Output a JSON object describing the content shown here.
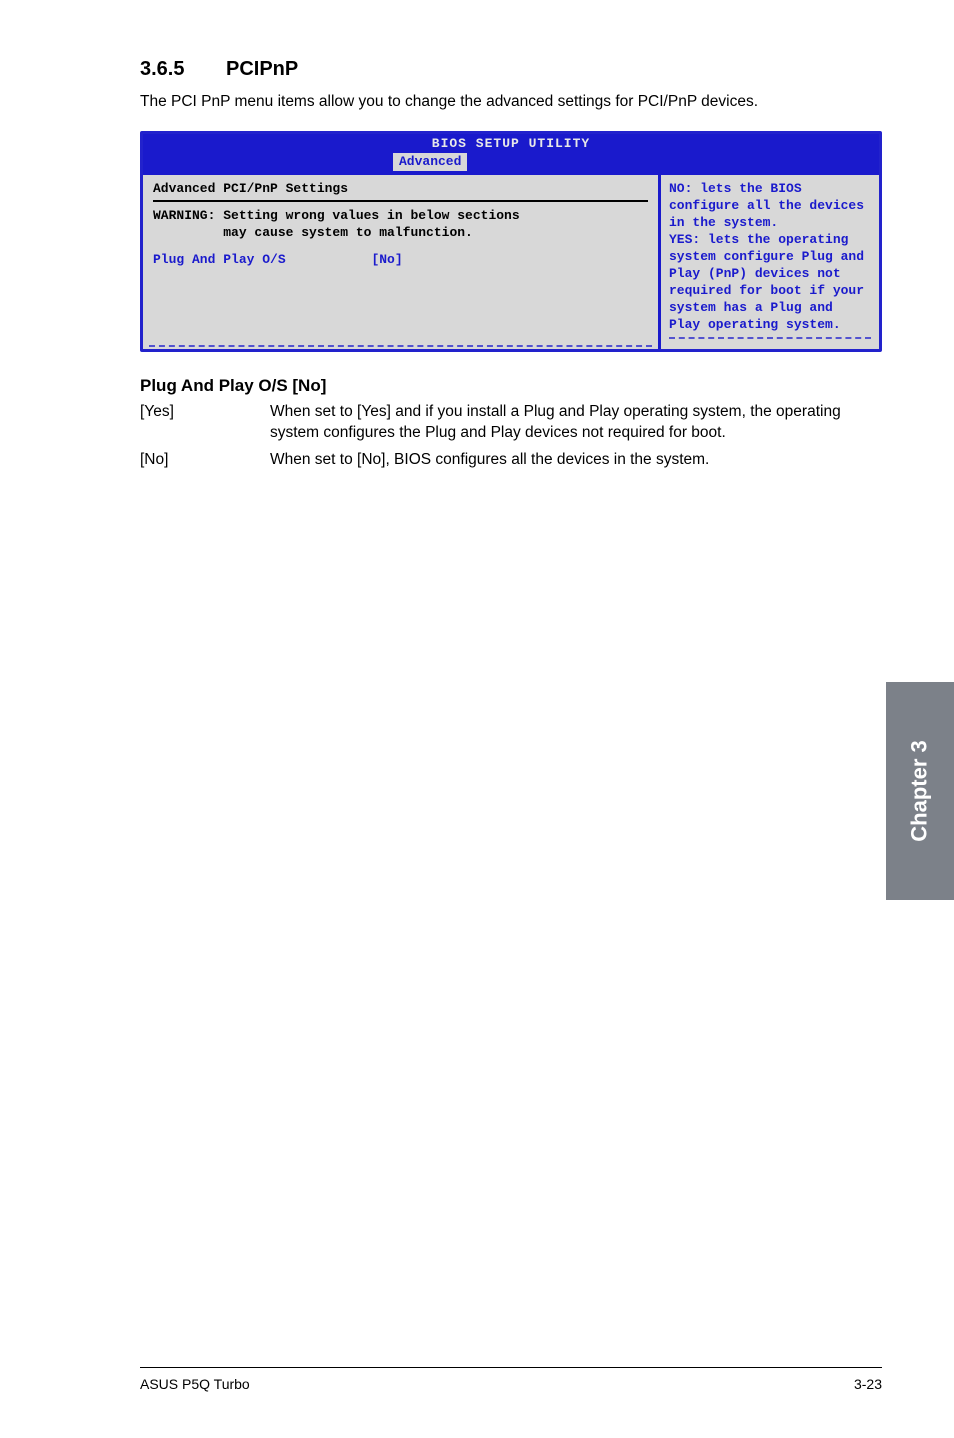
{
  "section": {
    "number": "3.6.5",
    "title": "PCIPnP",
    "intro": "The PCI PnP menu items allow you to change the advanced settings for PCI/PnP devices."
  },
  "bios": {
    "utility_title": "BIOS SETUP UTILITY",
    "tab": "Advanced",
    "panel_heading": "Advanced PCI/PnP Settings",
    "warning_line1": "WARNING: Setting wrong values in below sections",
    "warning_line2": "         may cause system to malfunction.",
    "option_label": "Plug And Play O/S",
    "option_value": "[No]",
    "help_text": "NO: lets the BIOS configure all the devices in the system.\nYES: lets the operating system configure Plug and Play (PnP) devices not required for boot if your system has a Plug and Play operating system."
  },
  "subsection": {
    "heading": "Plug And Play O/S [No]",
    "options": [
      {
        "key": "[Yes]",
        "desc": "When set to [Yes] and if you install a Plug and Play operating system, the operating system configures the Plug and Play devices not required for boot."
      },
      {
        "key": "[No]",
        "desc": "When set to [No], BIOS configures all the devices in the system."
      }
    ]
  },
  "side_tab": "Chapter 3",
  "footer": {
    "left": "ASUS P5Q Turbo",
    "right": "3-23"
  }
}
